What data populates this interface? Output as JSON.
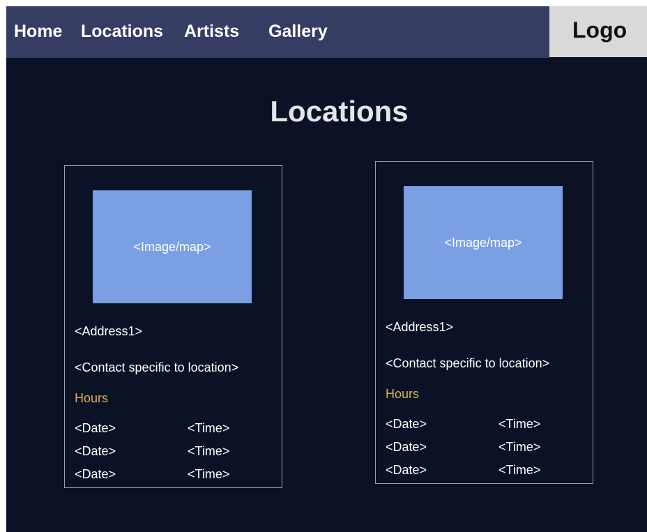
{
  "nav": {
    "items": [
      {
        "label": "Home"
      },
      {
        "label": "Locations"
      },
      {
        "label": "Artists"
      },
      {
        "label": "Gallery"
      }
    ],
    "logo": "Logo"
  },
  "page": {
    "title": "Locations"
  },
  "locations": [
    {
      "image_placeholder": "<Image/map>",
      "address": "<Address1>",
      "contact": "<Contact specific to location>",
      "hours_label": "Hours",
      "hours": [
        {
          "date": "<Date>",
          "time": "<Time>"
        },
        {
          "date": "<Date>",
          "time": "<Time>"
        },
        {
          "date": "<Date>",
          "time": "<Time>"
        }
      ]
    },
    {
      "image_placeholder": "<Image/map>",
      "address": "<Address1>",
      "contact": "<Contact specific to location>",
      "hours_label": "Hours",
      "hours": [
        {
          "date": "<Date>",
          "time": "<Time>"
        },
        {
          "date": "<Date>",
          "time": "<Time>"
        },
        {
          "date": "<Date>",
          "time": "<Time>"
        }
      ]
    }
  ]
}
